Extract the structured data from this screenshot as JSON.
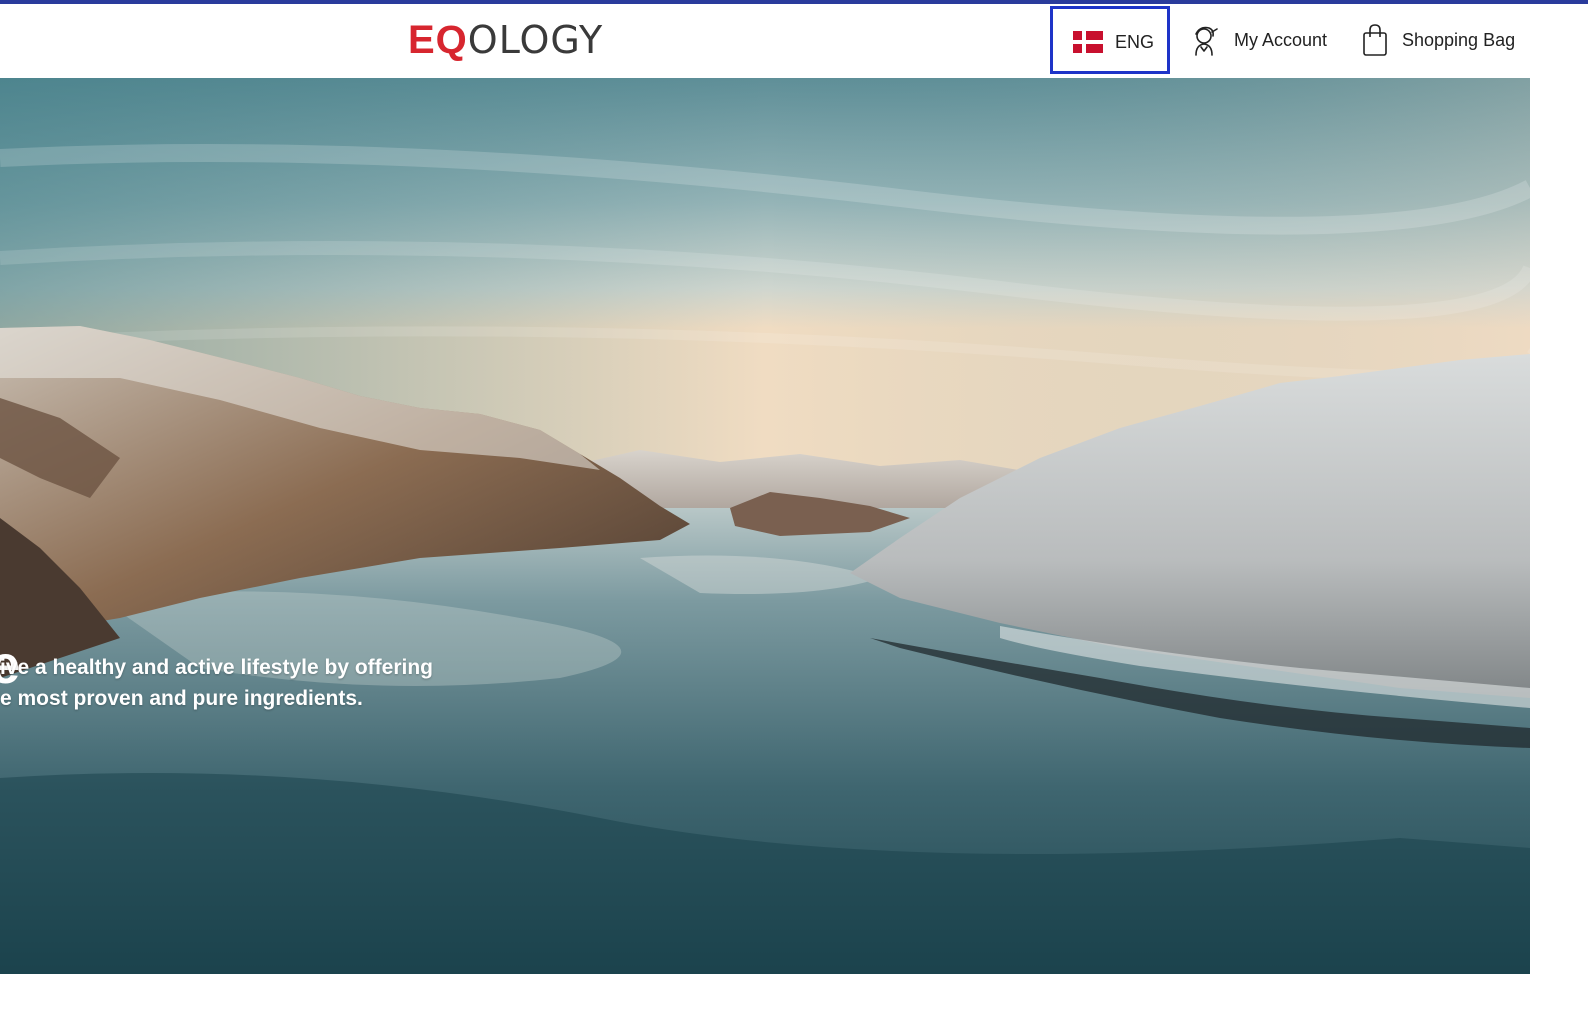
{
  "header": {
    "logo": {
      "part1": "EQ",
      "part2": "OLOGY"
    },
    "language": {
      "label": "ENG",
      "flag": "danish-flag-icon"
    },
    "account_label": "My Account",
    "bag_label": "Shopping Bag"
  },
  "hero": {
    "heading_fragment": "e",
    "text_line1": "ive a healthy and active lifestyle by offering",
    "text_line2": "e most proven and pure ingredients."
  },
  "colors": {
    "accent_strip": "#2a3b9c",
    "focus_border": "#1e34c8",
    "logo_red": "#d7262f",
    "flag_red": "#c8102e"
  }
}
